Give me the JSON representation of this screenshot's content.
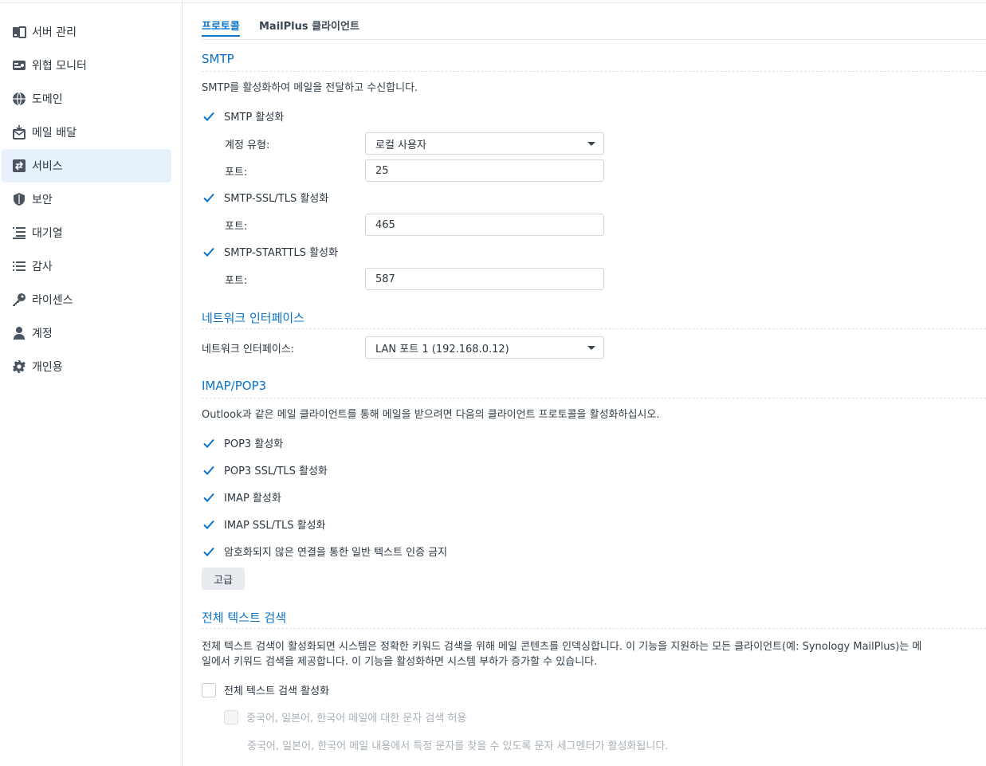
{
  "sidebar": {
    "items": [
      {
        "label": "서버 관리",
        "icon": "server-icon",
        "active": false
      },
      {
        "label": "위협 모니터",
        "icon": "monitor-icon",
        "active": false
      },
      {
        "label": "도메인",
        "icon": "globe-icon",
        "active": false
      },
      {
        "label": "메일 배달",
        "icon": "mail-delivery-icon",
        "active": false
      },
      {
        "label": "서비스",
        "icon": "service-icon",
        "active": true
      },
      {
        "label": "보안",
        "icon": "shield-icon",
        "active": false
      },
      {
        "label": "대기열",
        "icon": "queue-icon",
        "active": false
      },
      {
        "label": "감사",
        "icon": "audit-list-icon",
        "active": false
      },
      {
        "label": "라이센스",
        "icon": "key-icon",
        "active": false
      },
      {
        "label": "계정",
        "icon": "user-icon",
        "active": false
      },
      {
        "label": "개인용",
        "icon": "gear-icon",
        "active": false
      }
    ]
  },
  "tabs": [
    {
      "label": "프로토콜",
      "active": true
    },
    {
      "label": "MailPlus 클라이언트",
      "active": false
    }
  ],
  "smtp": {
    "title": "SMTP",
    "description": "SMTP를 활성화하여 메일을 전달하고 수신합니다.",
    "enable_label": "SMTP 활성화",
    "account_type_label": "계정 유형:",
    "account_type_value": "로컬 사용자",
    "port_label": "포트:",
    "port_value": "25",
    "ssl_label": "SMTP-SSL/TLS 활성화",
    "ssl_port_value": "465",
    "starttls_label": "SMTP-STARTTLS 활성화",
    "starttls_port_value": "587"
  },
  "network": {
    "title": "네트워크 인터페이스",
    "label": "네트워크 인터페이스:",
    "value": "LAN 포트 1 (192.168.0.12)"
  },
  "imap": {
    "title": "IMAP/POP3",
    "description": "Outlook과 같은 메일 클라이언트를 통해 메일을 받으려면 다음의 클라이언트 프로토콜을 활성화하십시오.",
    "pop3": "POP3 활성화",
    "pop3_ssl": "POP3 SSL/TLS 활성화",
    "imap": "IMAP 활성화",
    "imap_ssl": "IMAP SSL/TLS 활성화",
    "no_plaintext": "암호화되지 않은 연결을 통한 일반 텍스트 인증 금지",
    "advanced_button": "고급"
  },
  "fulltext": {
    "title": "전체 텍스트 검색",
    "description_line1": "전체 텍스트 검색이 활성화되면 시스템은 정확한 키워드 검색을 위해 메일 콘텐츠를 인덱싱합니다. 이 기능을 지원하는 모든 클라이언트(예: Synology MailPlus)는 메",
    "description_line2": "일에서 키워드 검색을 제공합니다. 이 기능을 활성화하면 시스템 부하가 증가할 수 있습니다.",
    "enable_label": "전체 텍스트 검색 활성화",
    "cjk_label": "중국어, 일본어, 한국어 메일에 대한 문자 검색 허용",
    "cjk_note": "중국어, 일본어, 한국어 메일 내용에서 특정 문자를 찾을 수 있도록 문자 세그멘터가 활성화됩니다."
  },
  "colors": {
    "accent": "#0a73c7",
    "active_bg": "#e7f1fc"
  }
}
